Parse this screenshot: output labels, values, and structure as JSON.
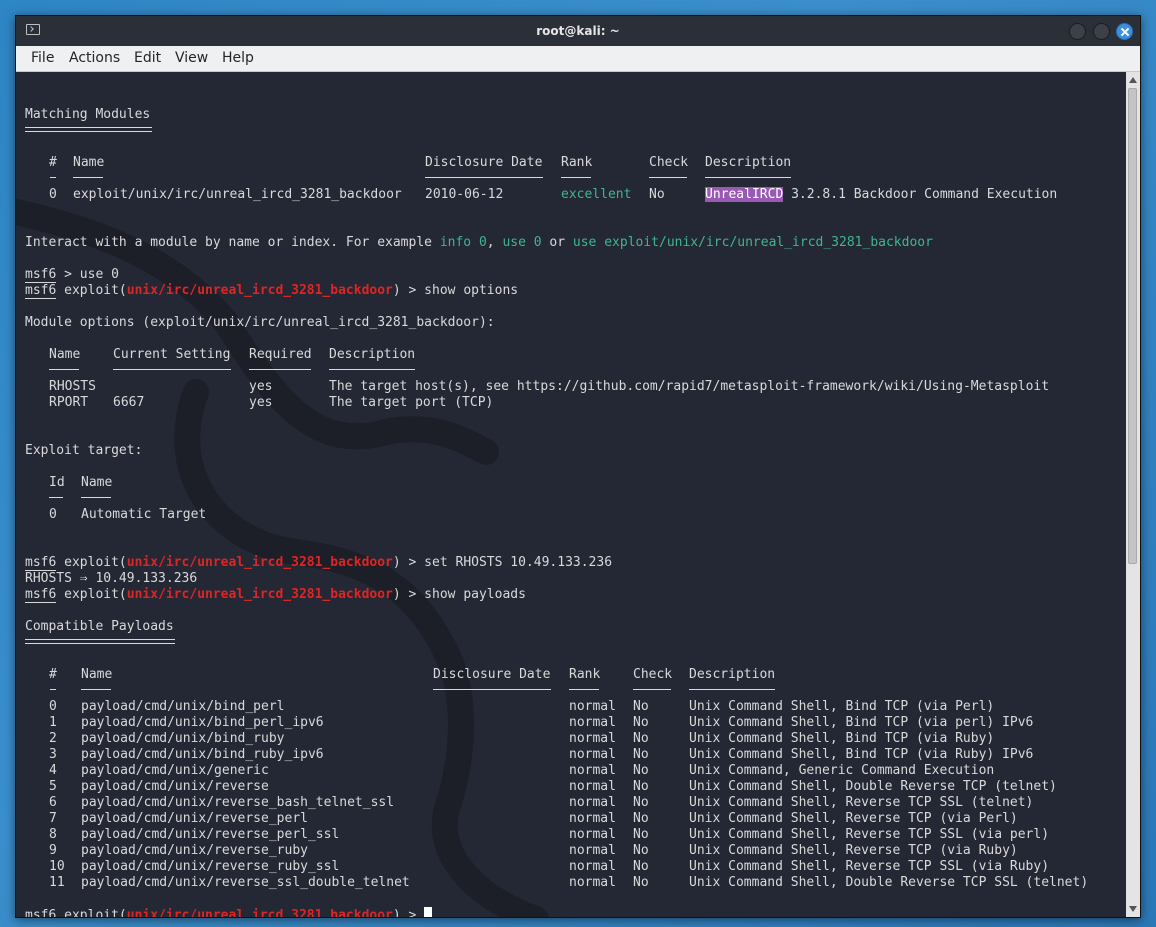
{
  "window": {
    "title": "root@kali: ~"
  },
  "menu": [
    "File",
    "Actions",
    "Edit",
    "View",
    "Help"
  ],
  "prompt": {
    "msf": "msf6",
    "exploit_word": "exploit(",
    "module": "unix/irc/unreal_ircd_3281_backdoor",
    "close": ") >"
  },
  "search": {
    "heading": "Matching Modules",
    "headers": [
      "#",
      "Name",
      "Disclosure Date",
      "Rank",
      "Check",
      "Description"
    ],
    "row": {
      "index": "0",
      "name": "exploit/unix/irc/unreal_ircd_3281_backdoor",
      "date": "2010-06-12",
      "rank": "excellent",
      "check": "No",
      "desc_highlight": "UnrealIRCD",
      "desc_rest": " 3.2.8.1 Backdoor Command Execution"
    },
    "interact_prefix": "Interact with a module by name or index. For example ",
    "interact_info": "info 0",
    "interact_sep1": ", ",
    "interact_use": "use 0",
    "interact_sep2": " or ",
    "interact_use_full": "use exploit/unix/irc/unreal_ircd_3281_backdoor"
  },
  "commands": {
    "use0": " > use 0",
    "show_options": " show options",
    "set_rhosts": " set RHOSTS 10.49.133.236",
    "rhosts_echo": "RHOSTS ⇒ 10.49.133.236",
    "show_payloads": " show payloads"
  },
  "options": {
    "heading": "Module options (exploit/unix/irc/unreal_ircd_3281_backdoor):",
    "headers": [
      "Name",
      "Current Setting",
      "Required",
      "Description"
    ],
    "rows": [
      {
        "name": "RHOSTS",
        "setting": "",
        "required": "yes",
        "desc": "The target host(s), see https://github.com/rapid7/metasploit-framework/wiki/Using-Metasploit"
      },
      {
        "name": "RPORT",
        "setting": "6667",
        "required": "yes",
        "desc": "The target port (TCP)"
      }
    ]
  },
  "target": {
    "heading": "Exploit target:",
    "headers": [
      "Id",
      "Name"
    ],
    "row": {
      "id": "0",
      "name": "Automatic Target"
    }
  },
  "payloads": {
    "heading": "Compatible Payloads",
    "headers": [
      "#",
      "Name",
      "Disclosure Date",
      "Rank",
      "Check",
      "Description"
    ],
    "rows": [
      {
        "i": "0",
        "name": "payload/cmd/unix/bind_perl",
        "rank": "normal",
        "check": "No",
        "desc": "Unix Command Shell, Bind TCP (via Perl)"
      },
      {
        "i": "1",
        "name": "payload/cmd/unix/bind_perl_ipv6",
        "rank": "normal",
        "check": "No",
        "desc": "Unix Command Shell, Bind TCP (via perl) IPv6"
      },
      {
        "i": "2",
        "name": "payload/cmd/unix/bind_ruby",
        "rank": "normal",
        "check": "No",
        "desc": "Unix Command Shell, Bind TCP (via Ruby)"
      },
      {
        "i": "3",
        "name": "payload/cmd/unix/bind_ruby_ipv6",
        "rank": "normal",
        "check": "No",
        "desc": "Unix Command Shell, Bind TCP (via Ruby) IPv6"
      },
      {
        "i": "4",
        "name": "payload/cmd/unix/generic",
        "rank": "normal",
        "check": "No",
        "desc": "Unix Command, Generic Command Execution"
      },
      {
        "i": "5",
        "name": "payload/cmd/unix/reverse",
        "rank": "normal",
        "check": "No",
        "desc": "Unix Command Shell, Double Reverse TCP (telnet)"
      },
      {
        "i": "6",
        "name": "payload/cmd/unix/reverse_bash_telnet_ssl",
        "rank": "normal",
        "check": "No",
        "desc": "Unix Command Shell, Reverse TCP SSL (telnet)"
      },
      {
        "i": "7",
        "name": "payload/cmd/unix/reverse_perl",
        "rank": "normal",
        "check": "No",
        "desc": "Unix Command Shell, Reverse TCP (via Perl)"
      },
      {
        "i": "8",
        "name": "payload/cmd/unix/reverse_perl_ssl",
        "rank": "normal",
        "check": "No",
        "desc": "Unix Command Shell, Reverse TCP SSL (via perl)"
      },
      {
        "i": "9",
        "name": "payload/cmd/unix/reverse_ruby",
        "rank": "normal",
        "check": "No",
        "desc": "Unix Command Shell, Reverse TCP (via Ruby)"
      },
      {
        "i": "10",
        "name": "payload/cmd/unix/reverse_ruby_ssl",
        "rank": "normal",
        "check": "No",
        "desc": "Unix Command Shell, Reverse TCP SSL (via Ruby)"
      },
      {
        "i": "11",
        "name": "payload/cmd/unix/reverse_ssl_double_telnet",
        "rank": "normal",
        "check": "No",
        "desc": "Unix Command Shell, Double Reverse TCP SSL (telnet)"
      }
    ]
  },
  "colors": {
    "prompt_module": "#e02424",
    "hint": "#3fb58f",
    "highlight": "#9b59b6"
  },
  "icons": {
    "app": "terminal-icon",
    "close": "close-icon"
  }
}
